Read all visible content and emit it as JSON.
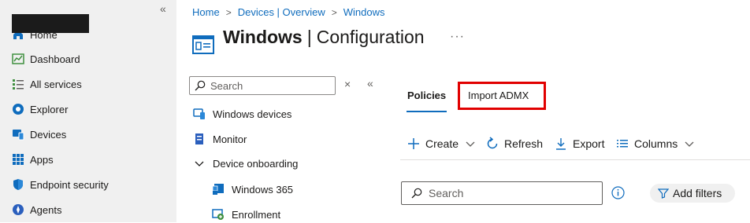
{
  "left_nav": {
    "collapse_glyph": "«",
    "items": [
      {
        "label": "Home",
        "icon": "home-icon"
      },
      {
        "label": "Dashboard",
        "icon": "dashboard-icon"
      },
      {
        "label": "All services",
        "icon": "all-services-icon"
      },
      {
        "label": "Explorer",
        "icon": "explorer-icon"
      },
      {
        "label": "Devices",
        "icon": "devices-icon"
      },
      {
        "label": "Apps",
        "icon": "apps-icon"
      },
      {
        "label": "Endpoint security",
        "icon": "endpoint-security-icon"
      },
      {
        "label": "Agents",
        "icon": "agents-icon"
      }
    ]
  },
  "breadcrumb": {
    "items": [
      "Home",
      "Devices | Overview",
      "Windows"
    ],
    "separator": ">"
  },
  "page": {
    "title_bold": "Windows",
    "title_sep": "|",
    "title_rest": "Configuration",
    "more_glyph": "···"
  },
  "resource_menu": {
    "search_placeholder": "Search",
    "close_glyph": "×",
    "collapse_glyph": "«",
    "items": [
      {
        "label": "Windows devices",
        "icon": "windows-devices-icon"
      },
      {
        "label": "Monitor",
        "icon": "monitor-icon"
      },
      {
        "label": "Device onboarding",
        "icon": "chevron-down-icon"
      },
      {
        "label": "Windows 365",
        "icon": "windows-365-icon"
      },
      {
        "label": "Enrollment",
        "icon": "enrollment-icon"
      }
    ]
  },
  "tabs": [
    {
      "label": "Policies",
      "selected": true
    },
    {
      "label": "Import ADMX",
      "selected": false
    }
  ],
  "toolbar": {
    "create": "Create",
    "refresh": "Refresh",
    "export": "Export",
    "columns": "Columns"
  },
  "filters": {
    "search_placeholder": "Search",
    "add_filters": "Add filters"
  },
  "colors": {
    "accent": "#0f6cbd",
    "highlight": "#e10000",
    "nav_bg": "#f0f0f0"
  }
}
